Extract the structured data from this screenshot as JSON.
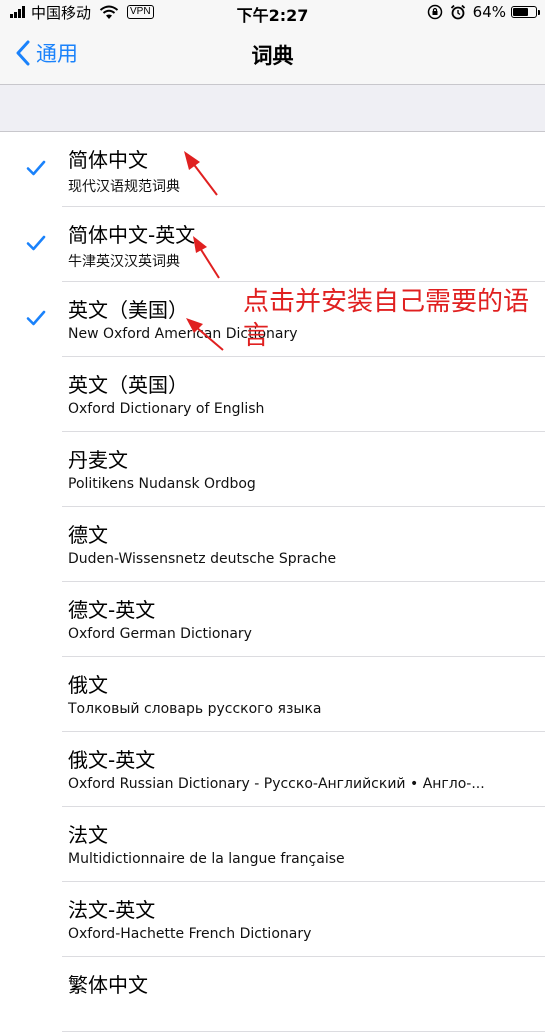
{
  "status_bar": {
    "carrier": "中国移动",
    "vpn": "VPN",
    "time": "下午2:27",
    "battery": "64%",
    "battery_level": 0.64
  },
  "nav": {
    "back_label": "通用",
    "title": "词典"
  },
  "colors": {
    "accent": "#1a82fb",
    "annotation": "#e02020"
  },
  "dictionaries": [
    {
      "title": "简体中文",
      "subtitle": "现代汉语规范词典",
      "checked": true
    },
    {
      "title": "简体中文-英文",
      "subtitle": "牛津英汉汉英词典",
      "checked": true
    },
    {
      "title": "英文（美国）",
      "subtitle": "New Oxford American Dictionary",
      "checked": true
    },
    {
      "title": "英文（英国）",
      "subtitle": "Oxford Dictionary of English",
      "checked": false
    },
    {
      "title": "丹麦文",
      "subtitle": "Politikens Nudansk Ordbog",
      "checked": false
    },
    {
      "title": "德文",
      "subtitle": "Duden-Wissensnetz deutsche Sprache",
      "checked": false
    },
    {
      "title": "德文-英文",
      "subtitle": "Oxford German Dictionary",
      "checked": false
    },
    {
      "title": "俄文",
      "subtitle": "Толковый словарь русского языка",
      "checked": false
    },
    {
      "title": "俄文-英文",
      "subtitle": "Oxford Russian Dictionary - Русско-Английский • Англо-...",
      "checked": false
    },
    {
      "title": "法文",
      "subtitle": "Multidictionnaire de la langue française",
      "checked": false
    },
    {
      "title": "法文-英文",
      "subtitle": "Oxford-Hachette French Dictionary",
      "checked": false
    },
    {
      "title": "繁体中文",
      "subtitle": "",
      "checked": false
    }
  ],
  "annotation": {
    "text": "点击并安装自己需要的语言"
  }
}
